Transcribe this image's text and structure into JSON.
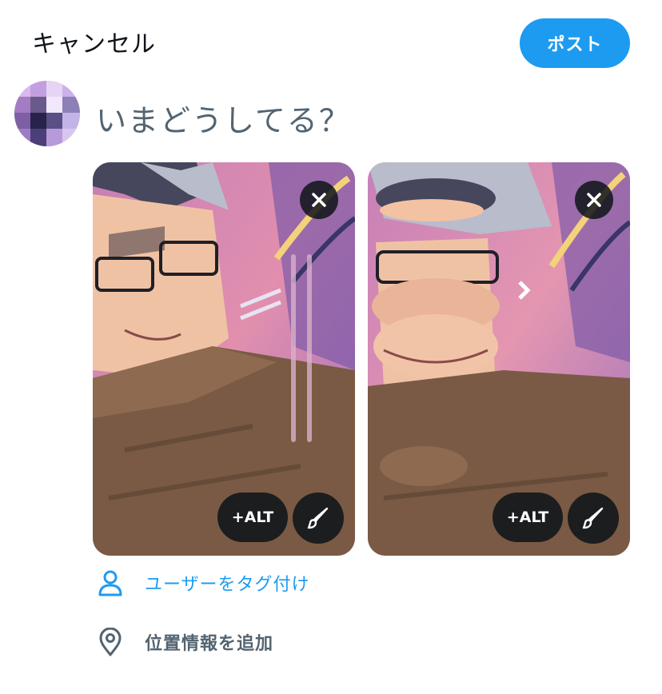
{
  "header": {
    "cancel_label": "キャンセル",
    "post_label": "ポスト"
  },
  "composer": {
    "prompt": "いまどうしてる？"
  },
  "media": [
    {
      "alt_label": "+ALT"
    },
    {
      "alt_label": "+ALT"
    }
  ],
  "actions": {
    "tag_users": "ユーザーをタグ付け",
    "add_location": "位置情報を追加"
  },
  "colors": {
    "accent": "#1d9bf0",
    "text_primary": "#0f1419",
    "text_secondary": "#536471",
    "overlay": "#0f1419"
  },
  "icons": {
    "remove": "close-icon",
    "edit": "brush-icon",
    "tag": "person-icon",
    "location": "location-pin-icon"
  }
}
